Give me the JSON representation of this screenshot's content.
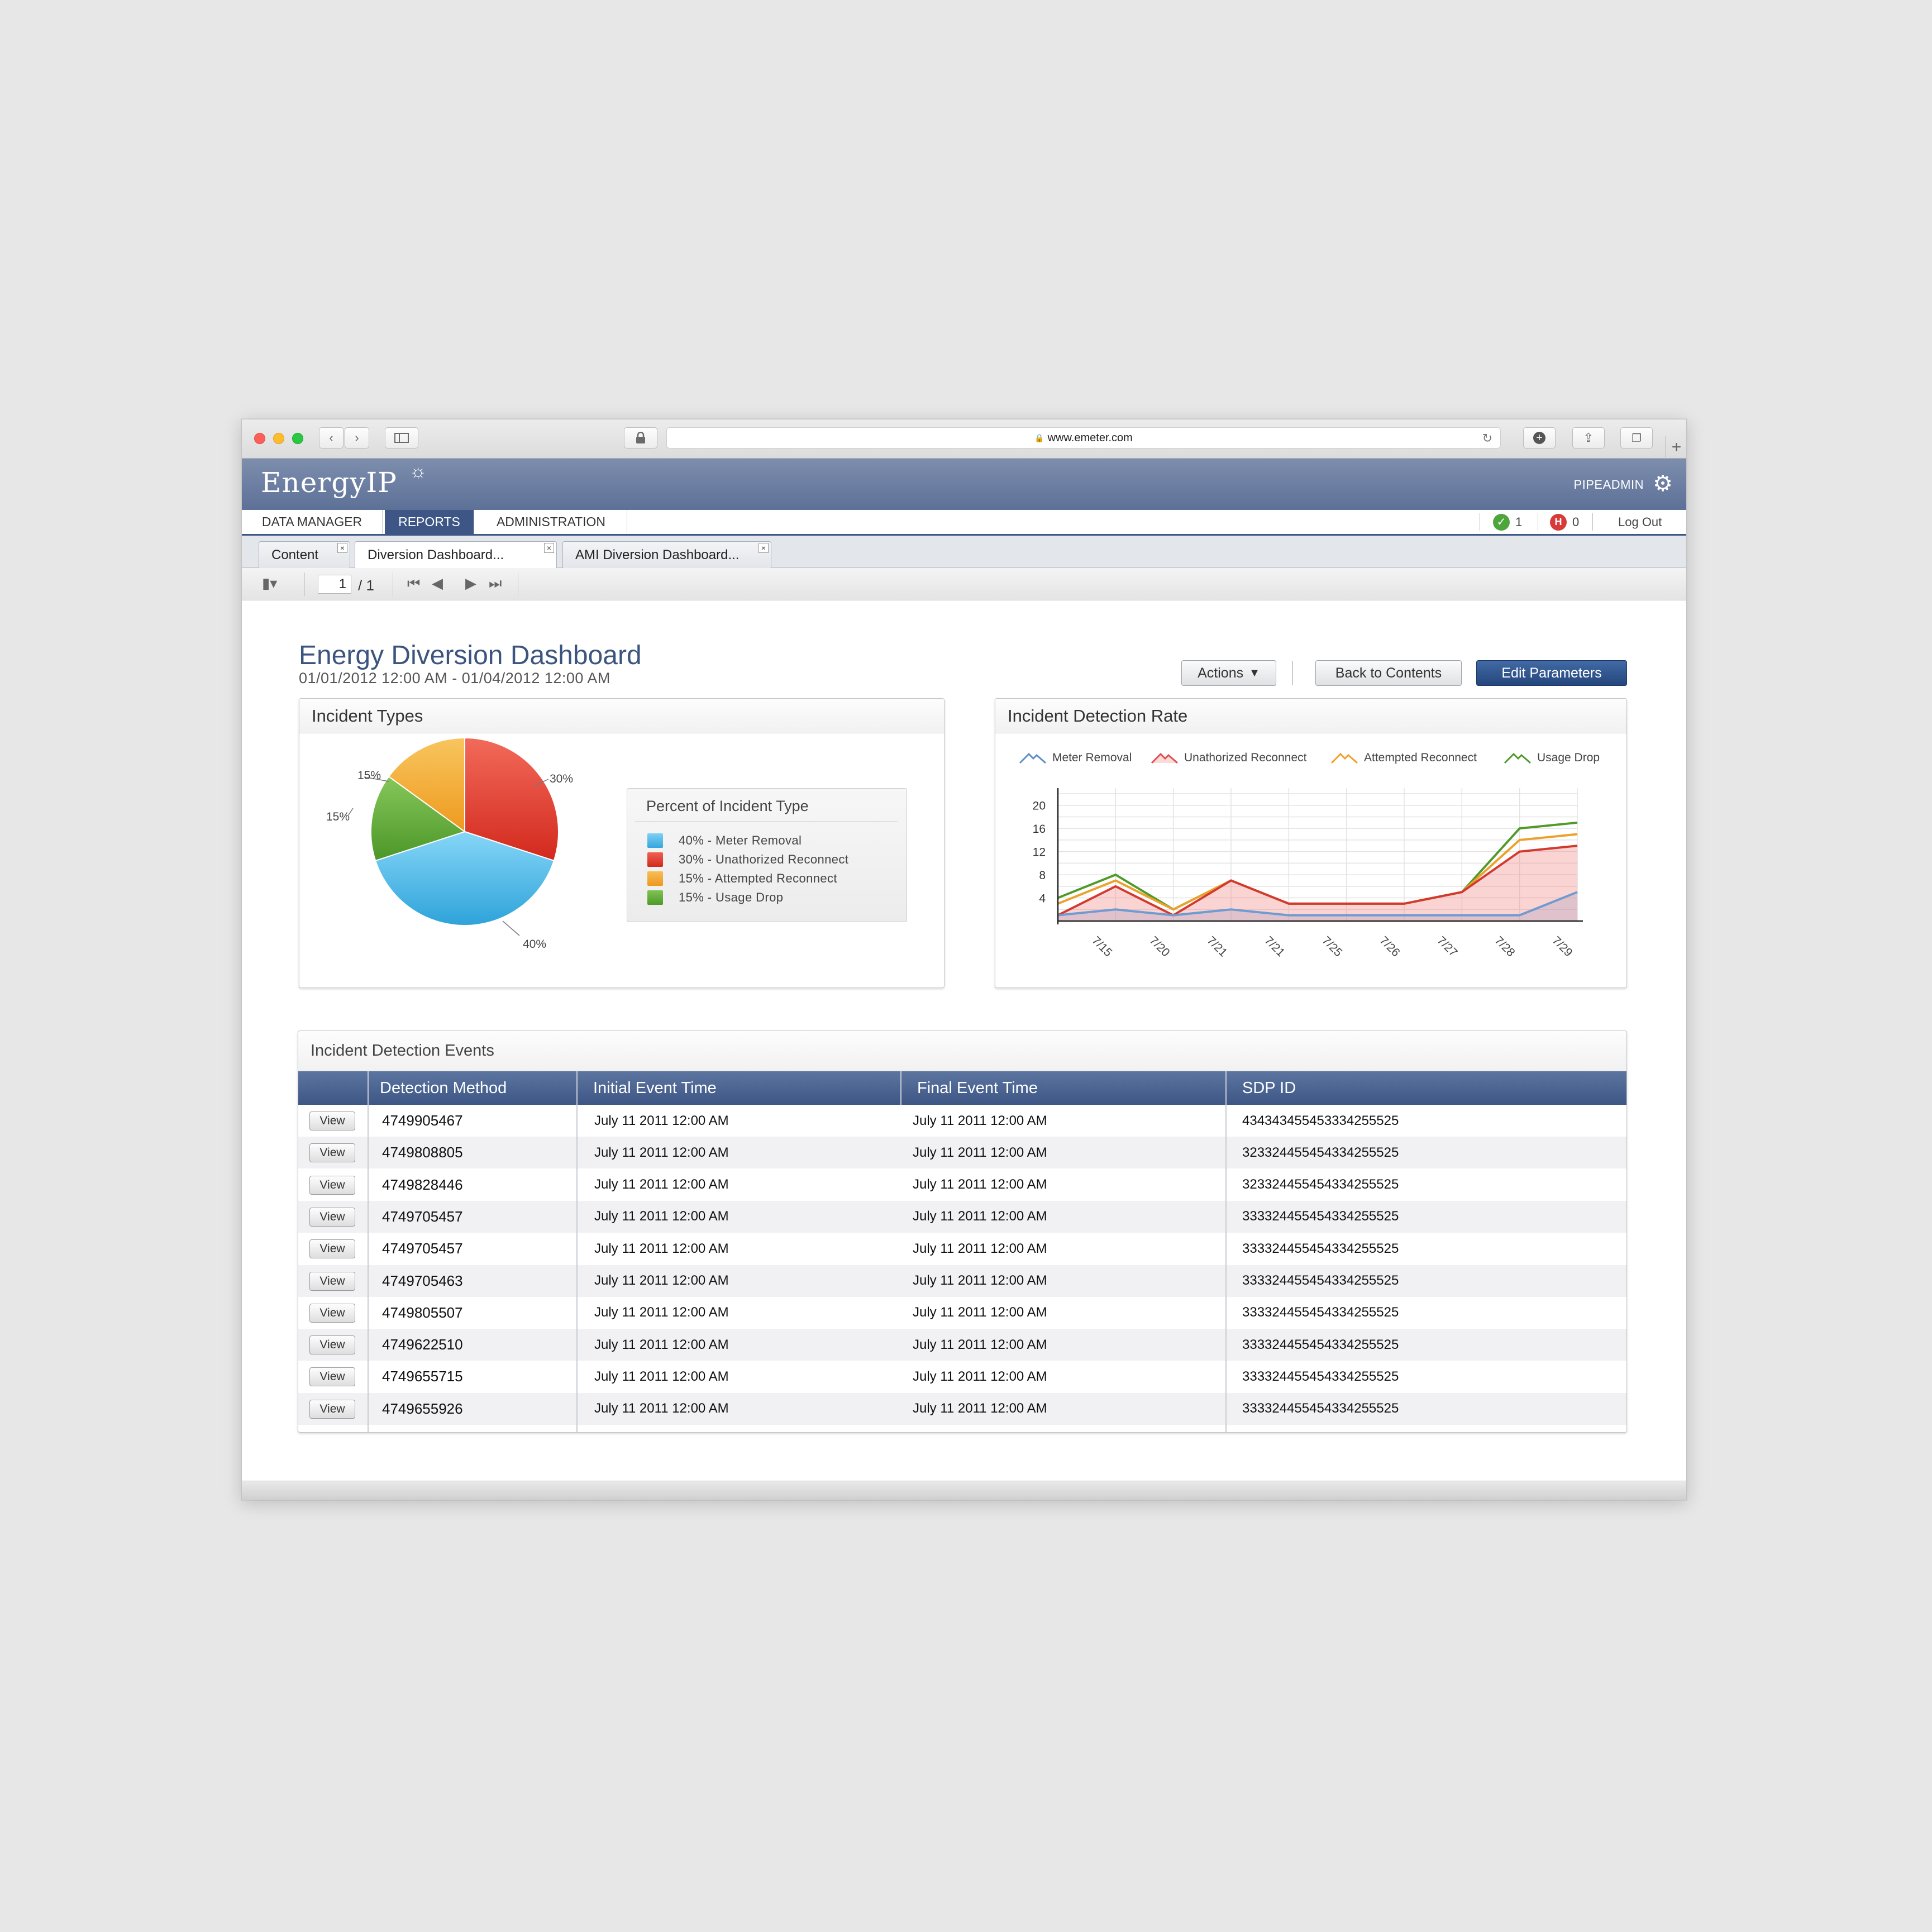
{
  "browser": {
    "url": "www.emeter.com",
    "lock_icon": "lock-icon",
    "back_icon": "chevron-left-icon",
    "forward_icon": "chevron-right-icon"
  },
  "header": {
    "logo": "EnergyIP",
    "user": "PIPEADMIN"
  },
  "nav": {
    "items": [
      "DATA MANAGER",
      "REPORTS",
      "ADMINISTRATION"
    ],
    "active": "REPORTS",
    "ok_count": "1",
    "error_count": "0",
    "logout": "Log Out"
  },
  "doc_tabs": [
    "Content",
    "Diversion Dashboard...",
    "AMI Diversion Dashboard..."
  ],
  "pager": {
    "current": "1",
    "total": "/ 1"
  },
  "page": {
    "title": "Energy Diversion Dashboard",
    "date_range": "01/01/2012 12:00 AM - 01/04/2012 12:00 AM",
    "actions_label": "Actions",
    "back_label": "Back to Contents",
    "edit_label": "Edit Parameters"
  },
  "incident_types": {
    "title": "Incident Types",
    "legend_title": "Percent of Incident Type",
    "legend": [
      "40% - Meter Removal",
      "30% - Unathorized Reconnect",
      "15% - Attempted Reconnect",
      "15% - Usage Drop"
    ],
    "labels": [
      "30%",
      "40%",
      "15%",
      "15%"
    ]
  },
  "detection_rate": {
    "title": "Incident Detection Rate",
    "legend": [
      "Meter Removal",
      "Unathorized Reconnect",
      "Attempted Reconnect",
      "Usage Drop"
    ]
  },
  "events": {
    "title": "Incident Detection Events",
    "columns": [
      "Detection Method",
      "Initial Event Time",
      "Final Event Time",
      "SDP ID"
    ],
    "view_label": "View",
    "rows": [
      {
        "method": "4749905467",
        "initial": "July 11 2011 12:00 AM",
        "final": "July 11 2011 12:00 AM",
        "sdp": "434343455453334255525"
      },
      {
        "method": "4749808805",
        "initial": "July 11 2011 12:00 AM",
        "final": "July 11 2011 12:00 AM",
        "sdp": "323324455454334255525"
      },
      {
        "method": "4749828446",
        "initial": "July 11 2011 12:00 AM",
        "final": "July 11 2011 12:00 AM",
        "sdp": "323324455454334255525"
      },
      {
        "method": "4749705457",
        "initial": "July 11 2011 12:00 AM",
        "final": "July 11 2011 12:00 AM",
        "sdp": "333324455454334255525"
      },
      {
        "method": "4749705457",
        "initial": "July 11 2011 12:00 AM",
        "final": "July 11 2011 12:00 AM",
        "sdp": "333324455454334255525"
      },
      {
        "method": "4749705463",
        "initial": "July 11 2011 12:00 AM",
        "final": "July 11 2011 12:00 AM",
        "sdp": "333324455454334255525"
      },
      {
        "method": "4749805507",
        "initial": "July 11 2011 12:00 AM",
        "final": "July 11 2011 12:00 AM",
        "sdp": "333324455454334255525"
      },
      {
        "method": "4749622510",
        "initial": "July 11 2011 12:00 AM",
        "final": "July 11 2011 12:00 AM",
        "sdp": "333324455454334255525"
      },
      {
        "method": "4749655715",
        "initial": "July 11 2011 12:00 AM",
        "final": "July 11 2011 12:00 AM",
        "sdp": "333324455454334255525"
      },
      {
        "method": "4749655926",
        "initial": "July 11 2011 12:00 AM",
        "final": "July 11 2011 12:00 AM",
        "sdp": "333324455454334255525"
      }
    ]
  },
  "colors": {
    "meter_removal": "#3fb2e8",
    "unauthorized": "#d9352a",
    "attempted": "#f0a22c",
    "usage_drop": "#5aa632",
    "header_blue": "#3d5685"
  },
  "chart_data": [
    {
      "type": "pie",
      "title": "Incident Types",
      "categories": [
        "Meter Removal",
        "Unathorized Reconnect",
        "Attempted Reconnect",
        "Usage Drop"
      ],
      "values": [
        40,
        30,
        15,
        15
      ]
    },
    {
      "type": "area",
      "title": "Incident Detection Rate",
      "categories": [
        "7/15",
        "7/20",
        "7/21",
        "7/21",
        "7/25",
        "7/26",
        "7/27",
        "7/28",
        "7/29"
      ],
      "x": [
        0,
        1,
        2,
        3,
        4,
        5,
        6,
        7,
        8,
        9
      ],
      "ylim": [
        0,
        22
      ],
      "yticks": [
        4,
        8,
        12,
        16,
        20
      ],
      "grid": true,
      "legend_position": "top",
      "series": [
        {
          "name": "Meter Removal",
          "values": [
            1,
            2,
            1,
            2,
            1,
            1,
            1,
            1,
            1,
            5
          ]
        },
        {
          "name": "Unathorized Reconnect",
          "values": [
            1,
            6,
            1,
            7,
            3,
            3,
            3,
            5,
            12,
            null
          ]
        },
        {
          "name": "Attempted Reconnect",
          "values": [
            3,
            7,
            2,
            7,
            3,
            3,
            3,
            5,
            14,
            null
          ]
        },
        {
          "name": "Usage Drop",
          "values": [
            4,
            8,
            2,
            7,
            3,
            3,
            3,
            5,
            16,
            null
          ]
        }
      ]
    }
  ]
}
